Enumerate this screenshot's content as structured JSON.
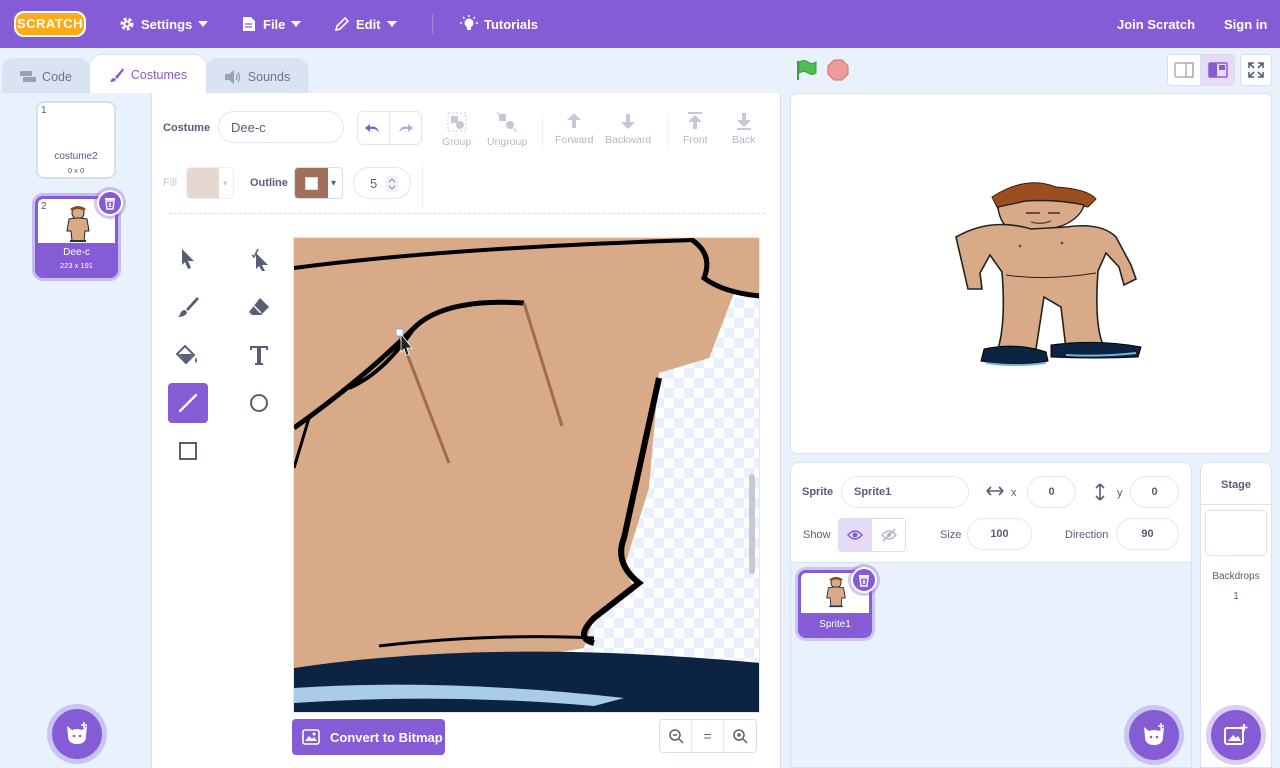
{
  "menubar": {
    "logo_text": "SCRATCH",
    "settings_label": "Settings",
    "file_label": "File",
    "edit_label": "Edit",
    "tutorials_label": "Tutorials",
    "join_label": "Join Scratch",
    "signin_label": "Sign in"
  },
  "tabs": [
    {
      "label": "Code"
    },
    {
      "label": "Costumes"
    },
    {
      "label": "Sounds"
    }
  ],
  "costumes": [
    {
      "number": "1",
      "name": "costume2",
      "dims": "0 x 0"
    },
    {
      "number": "2",
      "name": "Dee-c",
      "dims": "223 x 191"
    }
  ],
  "paint": {
    "costume_label": "Costume",
    "costume_name": "Dee-c",
    "group_label": "Group",
    "ungroup_label": "Ungroup",
    "forward_label": "Forward",
    "backward_label": "Backward",
    "front_label": "Front",
    "back_label": "Back",
    "fill_label": "Fill",
    "outline_label": "Outline",
    "outline_width": "5",
    "convert_label": "Convert to Bitmap",
    "zoom_reset": "="
  },
  "colors": {
    "accent": "#855cd6",
    "fill_swatch": "#e6d8d0",
    "outline_swatch": "#a0705a",
    "skin": "#d9aa88"
  },
  "sprite": {
    "sprite_label": "Sprite",
    "name": "Sprite1",
    "x_label": "x",
    "x_value": "0",
    "y_label": "y",
    "y_value": "0",
    "show_label": "Show",
    "size_label": "Size",
    "size_value": "100",
    "direction_label": "Direction",
    "direction_value": "90",
    "tile_name": "Sprite1"
  },
  "stage_selector": {
    "title": "Stage",
    "backdrops_label": "Backdrops",
    "backdrops_count": "1"
  }
}
